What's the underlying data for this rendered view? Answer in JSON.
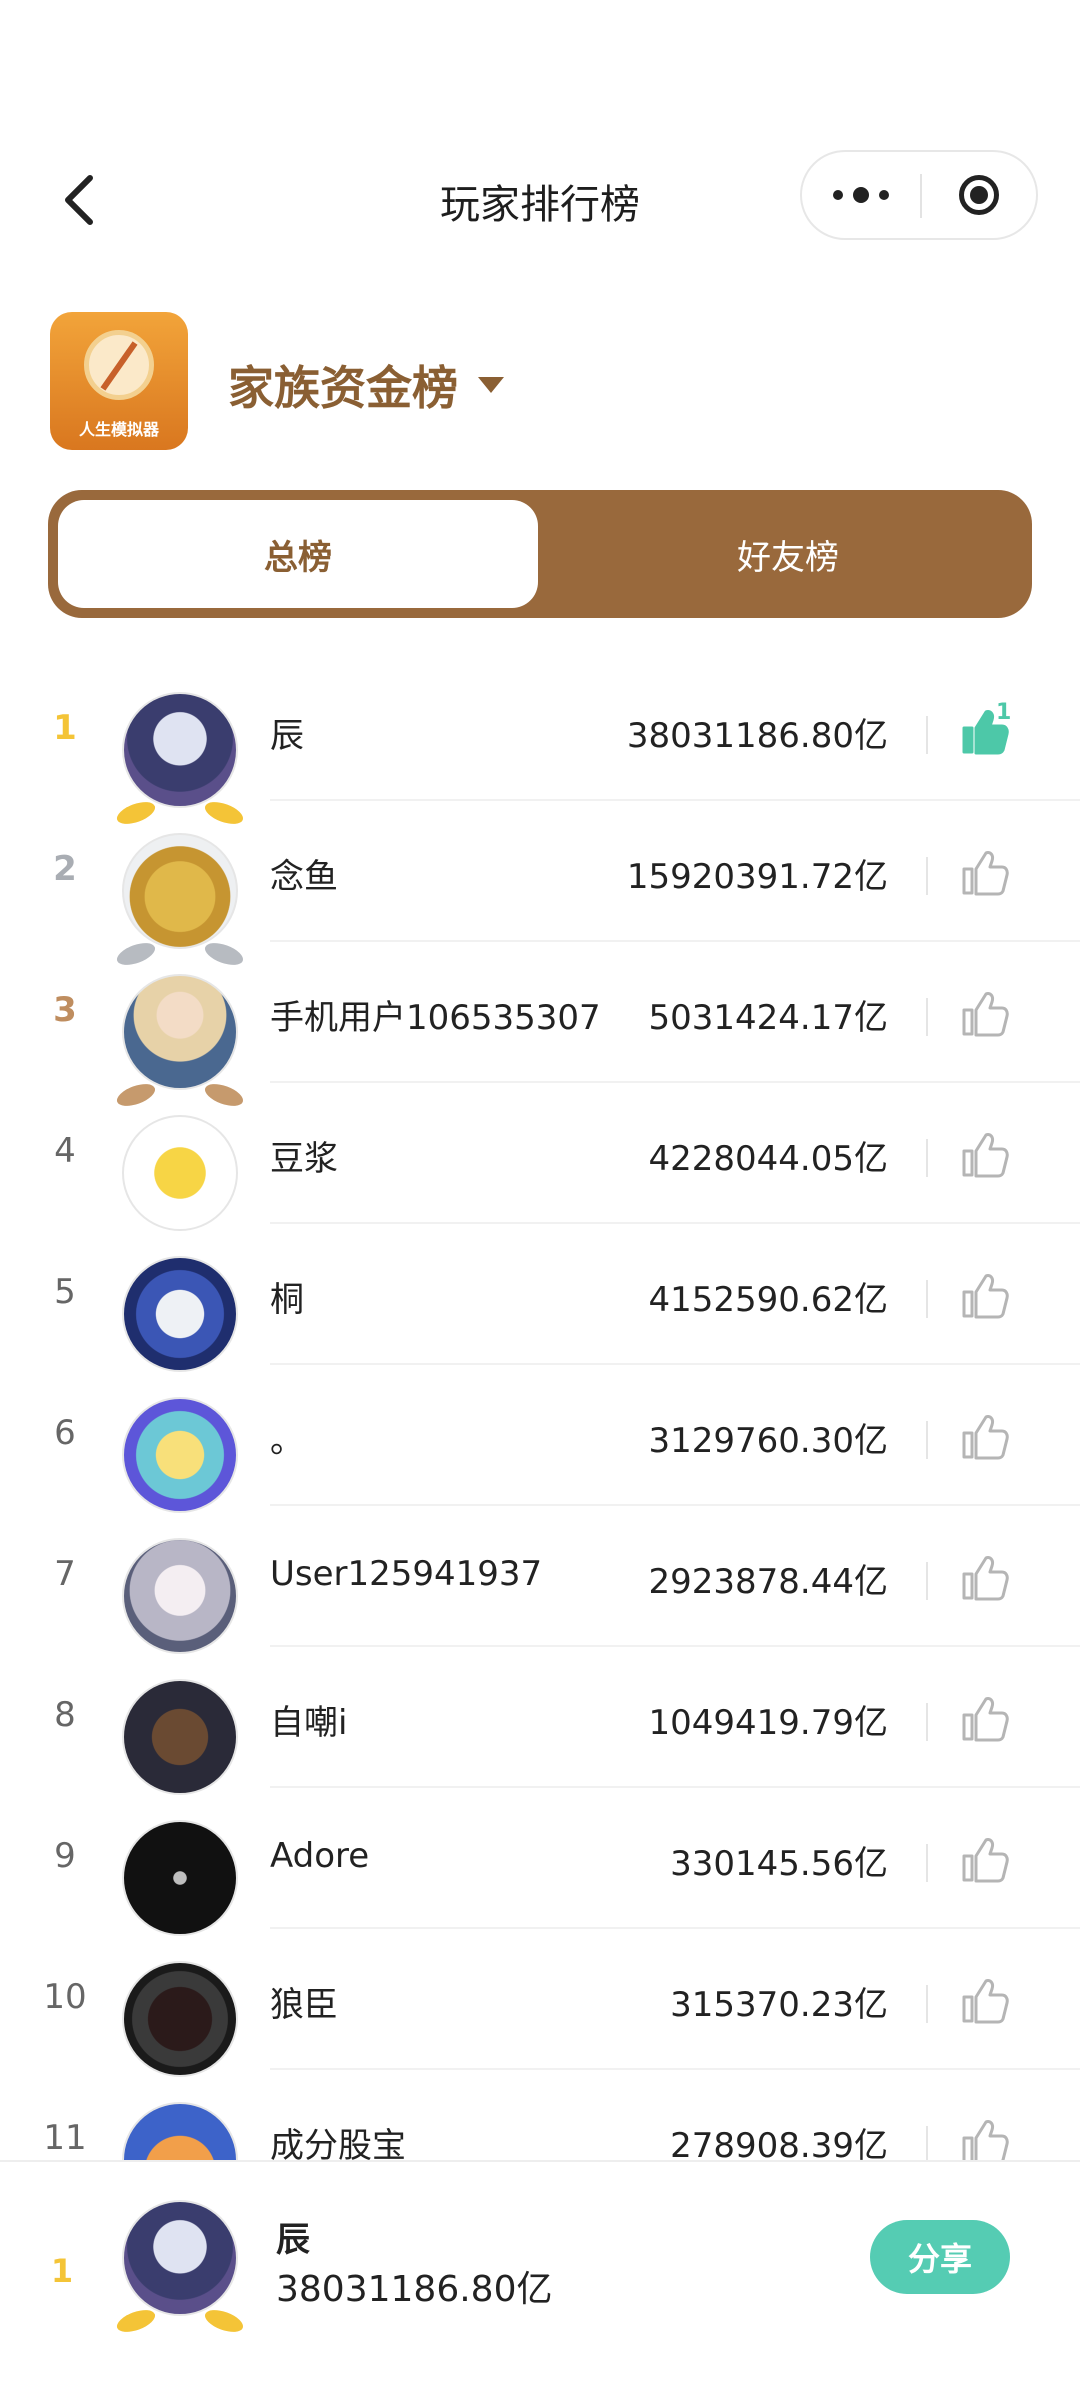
{
  "header": {
    "title": "玩家排行榜"
  },
  "game": {
    "icon_label": "人生模拟器",
    "board_title": "家族资金榜"
  },
  "tabs": [
    {
      "label": "总榜",
      "active": true
    },
    {
      "label": "好友榜",
      "active": false
    }
  ],
  "colors": {
    "accent": "#99693c",
    "brand_text": "#8a5f33",
    "like_active": "#4dc8a8",
    "gold": "#f4c437",
    "silver": "#a9adb3",
    "bronze": "#bf8d5f"
  },
  "rankings": [
    {
      "rank": "1",
      "name": "辰",
      "score": "38031186.80亿",
      "liked": true,
      "like_count": "1"
    },
    {
      "rank": "2",
      "name": "念鱼",
      "score": "15920391.72亿",
      "liked": false
    },
    {
      "rank": "3",
      "name": "手机用户106535307",
      "score": "5031424.17亿",
      "liked": false
    },
    {
      "rank": "4",
      "name": "豆浆",
      "score": "4228044.05亿",
      "liked": false
    },
    {
      "rank": "5",
      "name": "桐",
      "score": "4152590.62亿",
      "liked": false
    },
    {
      "rank": "6",
      "name": "。",
      "score": "3129760.30亿",
      "liked": false
    },
    {
      "rank": "7",
      "name": "User125941937",
      "score": "2923878.44亿",
      "liked": false
    },
    {
      "rank": "8",
      "name": "自嘲i",
      "score": "1049419.79亿",
      "liked": false
    },
    {
      "rank": "9",
      "name": "Adore",
      "score": "330145.56亿",
      "liked": false
    },
    {
      "rank": "10",
      "name": "狼臣",
      "score": "315370.23亿",
      "liked": false
    },
    {
      "rank": "11",
      "name": "成分股宝",
      "score": "278908.39亿",
      "liked": false
    }
  ],
  "my_rank": {
    "rank": "1",
    "name": "辰",
    "score": "38031186.80亿",
    "share_label": "分享"
  }
}
